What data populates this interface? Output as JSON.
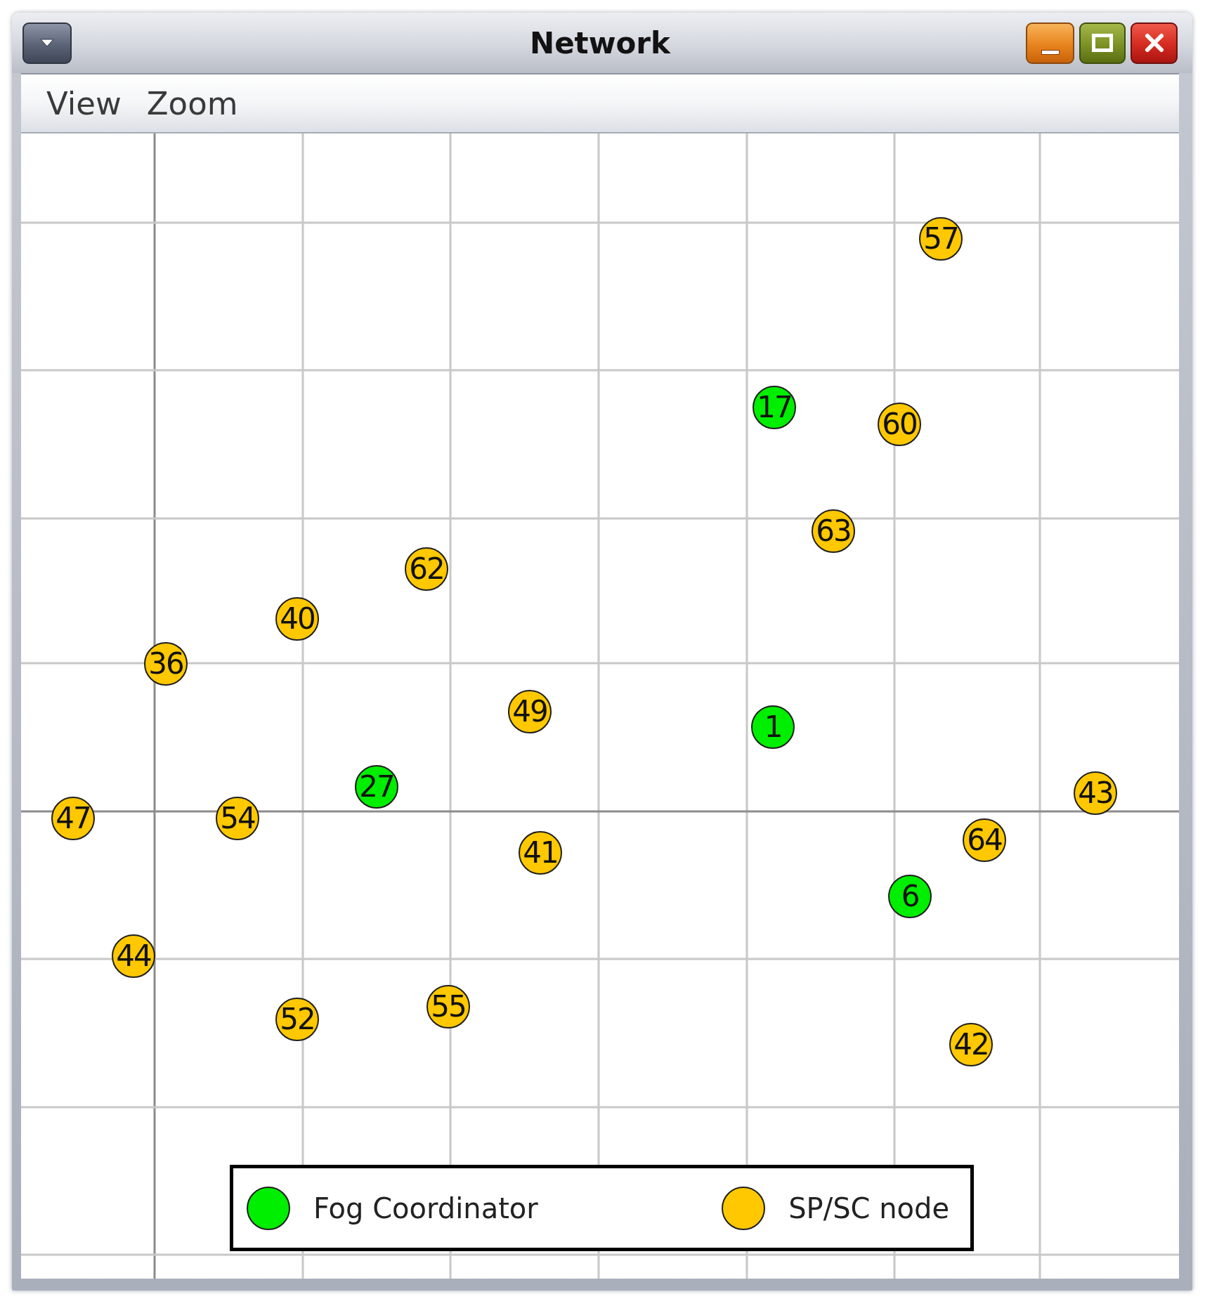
{
  "window": {
    "title": "Network"
  },
  "menu_bar": {
    "items": [
      {
        "label": "View"
      },
      {
        "label": "Zoom"
      }
    ]
  },
  "network": {
    "nodes": [
      {
        "label": "57",
        "color": "#ffc800"
      },
      {
        "label": "17",
        "color": "#00ee00"
      },
      {
        "label": "60",
        "color": "#ffc800"
      },
      {
        "label": "63",
        "color": "#ffc800"
      },
      {
        "label": "62",
        "color": "#ffc800"
      },
      {
        "label": "40",
        "color": "#ffc800"
      },
      {
        "label": "36",
        "color": "#ffc800"
      },
      {
        "label": "49",
        "color": "#ffc800"
      },
      {
        "label": "1",
        "color": "#00ee00"
      },
      {
        "label": "27",
        "color": "#00ee00"
      },
      {
        "label": "43",
        "color": "#ffc800"
      },
      {
        "label": "47",
        "color": "#ffc800"
      },
      {
        "label": "54",
        "color": "#ffc800"
      },
      {
        "label": "64",
        "color": "#ffc800"
      },
      {
        "label": "41",
        "color": "#ffc800"
      },
      {
        "label": "6",
        "color": "#00ee00"
      },
      {
        "label": "44",
        "color": "#ffc800"
      },
      {
        "label": "55",
        "color": "#ffc800"
      },
      {
        "label": "52",
        "color": "#ffc800"
      },
      {
        "label": "42",
        "color": "#ffc800"
      }
    ]
  },
  "legend": {
    "items": [
      {
        "label": "Fog Coordinator",
        "color": "#00ee00"
      },
      {
        "label": "SP/SC node",
        "color": "#ffc800"
      }
    ]
  }
}
